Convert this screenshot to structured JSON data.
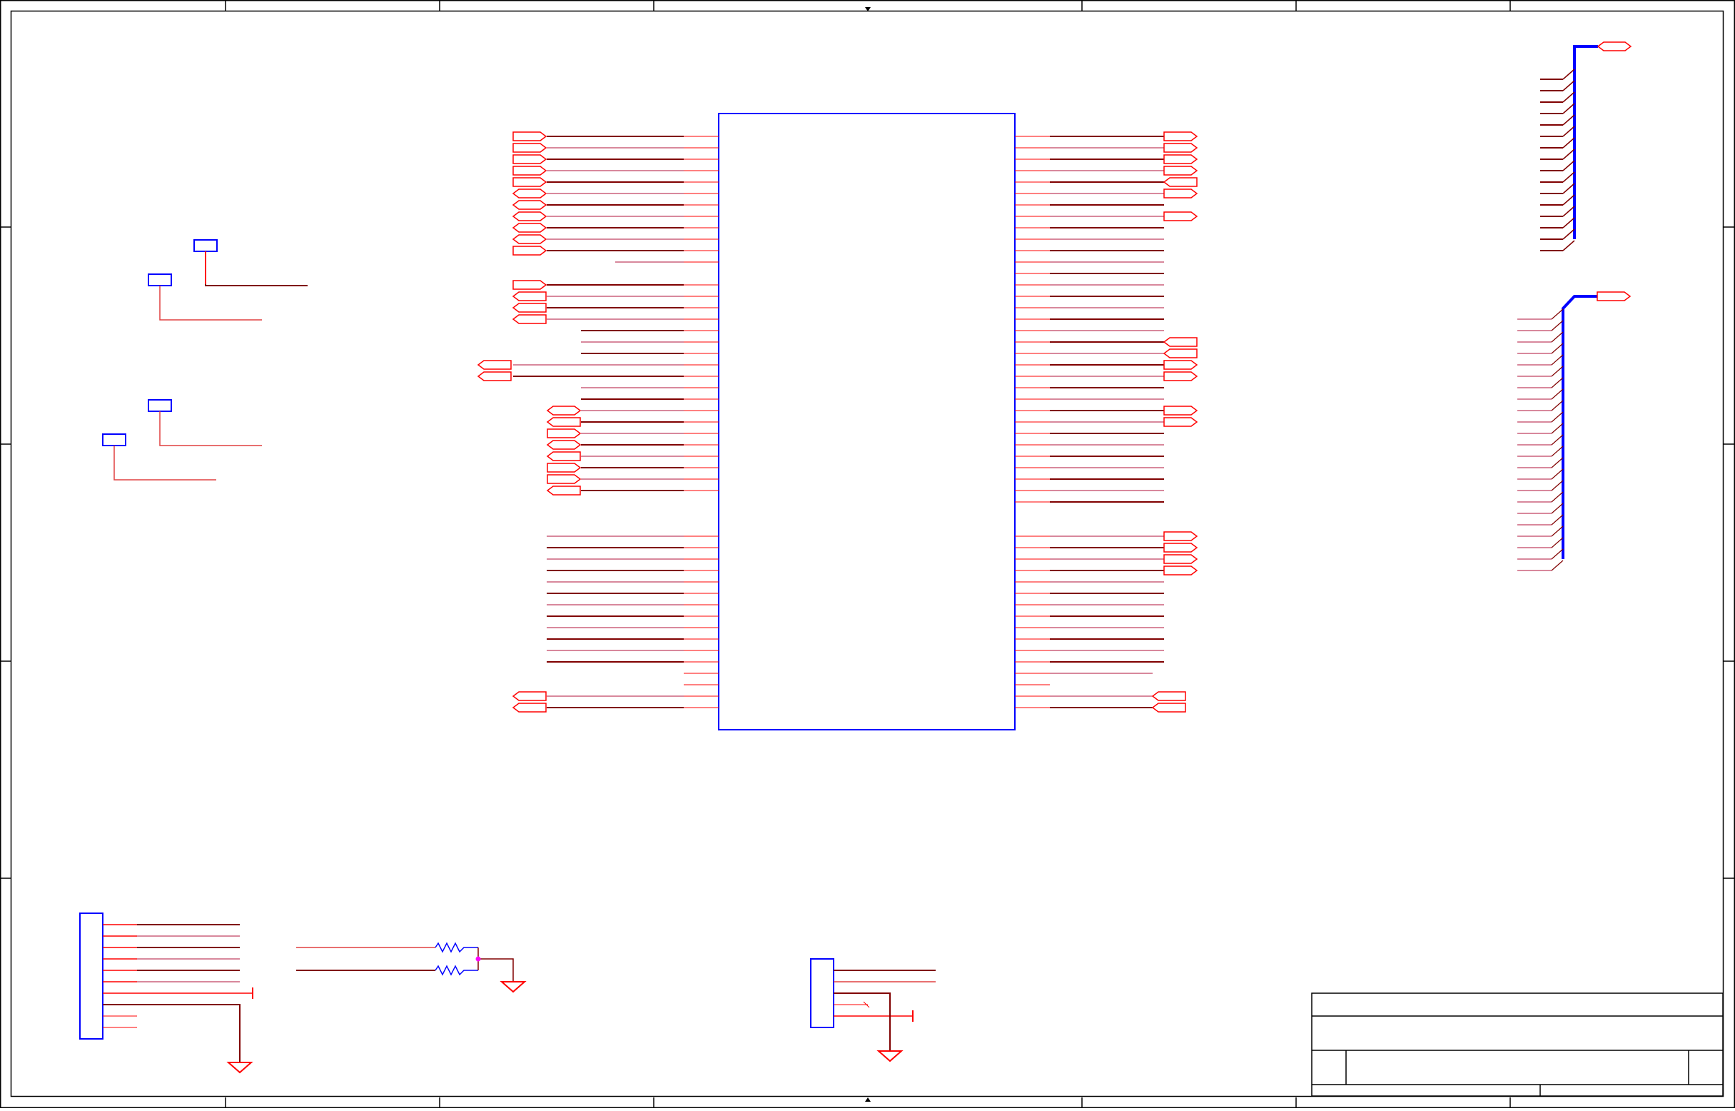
{
  "diagram": {
    "type": "schematic",
    "colors": {
      "border": "#000000",
      "component": "#0000ff",
      "pin": "#ff0000",
      "wire": "#800000",
      "junction": "#ff00ff",
      "bus": "#0000ff"
    },
    "icons": [
      "ground-symbol-icon",
      "power-port-icon",
      "resistor-icon",
      "net-port-icon",
      "no-connect-icon"
    ]
  }
}
